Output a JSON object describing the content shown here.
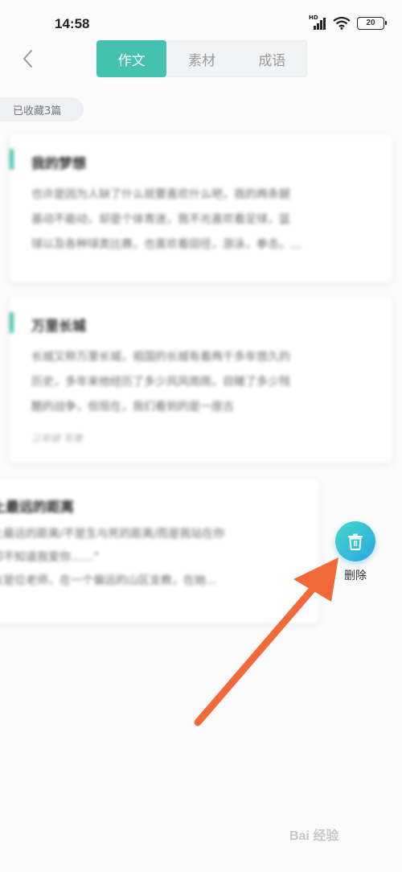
{
  "status_bar": {
    "time": "14:58",
    "network": "HD",
    "battery": "20"
  },
  "header": {
    "tabs": [
      {
        "label": "作文",
        "active": true
      },
      {
        "label": "素材",
        "active": false
      },
      {
        "label": "成语",
        "active": false
      }
    ]
  },
  "saved_count_label": "已收藏3篇",
  "cards": [
    {
      "title": "我的梦想",
      "excerpt": "也许是因为人缺了什么就要喜欢什么吧，我的两条腿\n基动不能动，却是个体育迷，我不光喜欢看足球，篮\n球以及各种球类比赛，也喜欢看田径，游泳，拳击。…",
      "meta": ""
    },
    {
      "title": "万里长城",
      "excerpt": "长城又称万里长城，祖国的长城有着两千多年悠久的\n历史，多年来他经历了多少风风雨雨，目睹了多少残\n酷的战争，但现在，我们看到的是一座古",
      "meta": "三年级 写景"
    },
    {
      "title": "上最远的距离",
      "excerpt": "上最远的距离/不是生与死的距离/而是我站在你\n却不知道我爱你……”\n友是位老师，在一个偏远的山区支教，在她…",
      "meta": ""
    }
  ],
  "delete_action": {
    "label": "删除",
    "icon": "trash-icon"
  },
  "colors": {
    "accent": "#45c1b0",
    "arrow": "#f2693a",
    "delete_gradient_start": "#45d8c8",
    "delete_gradient_end": "#2aa6e4"
  },
  "watermark": "Bai 经验"
}
